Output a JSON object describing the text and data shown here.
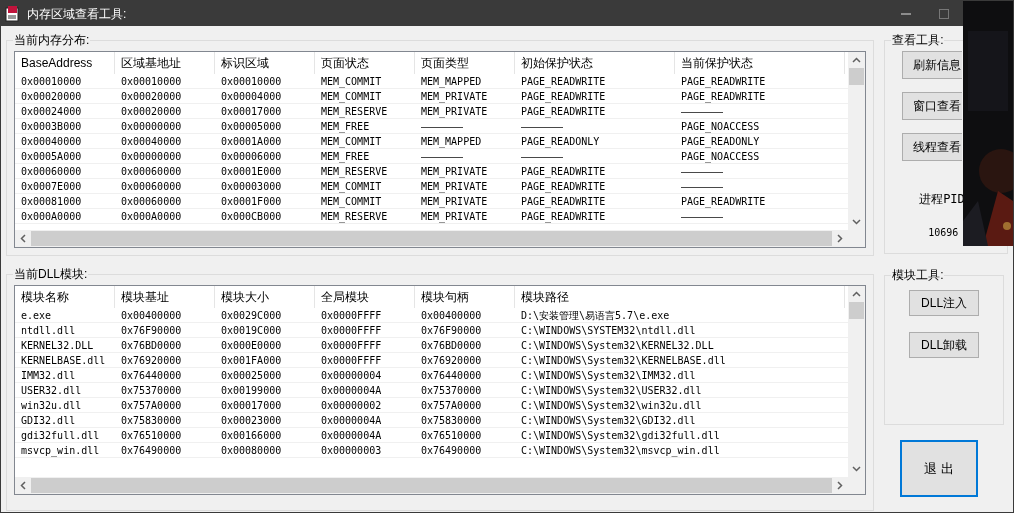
{
  "window": {
    "title": "内存区域查看工具:"
  },
  "memory_group": {
    "title": "当前内存分布:",
    "columns": [
      "BaseAddress",
      "区域基地址",
      "标识区域",
      "页面状态",
      "页面类型",
      "初始保护状态",
      "当前保护状态"
    ],
    "rows": [
      [
        "0x00010000",
        "0x00010000",
        "0x00010000",
        "MEM_COMMIT",
        "MEM_MAPPED",
        "PAGE_READWRITE",
        "PAGE_READWRITE"
      ],
      [
        "0x00020000",
        "0x00020000",
        "0x00004000",
        "MEM_COMMIT",
        "MEM_PRIVATE",
        "PAGE_READWRITE",
        "PAGE_READWRITE"
      ],
      [
        "0x00024000",
        "0x00020000",
        "0x00017000",
        "MEM_RESERVE",
        "MEM_PRIVATE",
        "PAGE_READWRITE",
        "———————"
      ],
      [
        "0x0003B000",
        "0x00000000",
        "0x00005000",
        "MEM_FREE",
        "———————",
        "———————",
        "PAGE_NOACCESS"
      ],
      [
        "0x00040000",
        "0x00040000",
        "0x0001A000",
        "MEM_COMMIT",
        "MEM_MAPPED",
        "PAGE_READONLY",
        "PAGE_READONLY"
      ],
      [
        "0x0005A000",
        "0x00000000",
        "0x00006000",
        "MEM_FREE",
        "———————",
        "———————",
        "PAGE_NOACCESS"
      ],
      [
        "0x00060000",
        "0x00060000",
        "0x0001E000",
        "MEM_RESERVE",
        "MEM_PRIVATE",
        "PAGE_READWRITE",
        "———————"
      ],
      [
        "0x0007E000",
        "0x00060000",
        "0x00003000",
        "MEM_COMMIT",
        "MEM_PRIVATE",
        "PAGE_READWRITE",
        "———————"
      ],
      [
        "0x00081000",
        "0x00060000",
        "0x0001F000",
        "MEM_COMMIT",
        "MEM_PRIVATE",
        "PAGE_READWRITE",
        "PAGE_READWRITE"
      ],
      [
        "0x000A0000",
        "0x000A0000",
        "0x000CB000",
        "MEM_RESERVE",
        "MEM_PRIVATE",
        "PAGE_READWRITE",
        "———————"
      ]
    ]
  },
  "view_tools": {
    "title": "查看工具:",
    "buttons": [
      "刷新信息",
      "窗口查看",
      "线程查看"
    ],
    "pid_label": "进程PID",
    "pid_value": "10696"
  },
  "dll_group": {
    "title": "当前DLL模块:",
    "columns": [
      "模块名称",
      "模块基址",
      "模块大小",
      "全局模块",
      "模块句柄",
      "模块路径"
    ],
    "rows": [
      [
        "e.exe",
        "0x00400000",
        "0x0029C000",
        "0x0000FFFF",
        "0x00400000",
        "D:\\安装管理\\易语言5.7\\e.exe"
      ],
      [
        "ntdll.dll",
        "0x76F90000",
        "0x0019C000",
        "0x0000FFFF",
        "0x76F90000",
        "C:\\WINDOWS\\SYSTEM32\\ntdll.dll"
      ],
      [
        "KERNEL32.DLL",
        "0x76BD0000",
        "0x000E0000",
        "0x0000FFFF",
        "0x76BD0000",
        "C:\\WINDOWS\\System32\\KERNEL32.DLL"
      ],
      [
        "KERNELBASE.dll",
        "0x76920000",
        "0x001FA000",
        "0x0000FFFF",
        "0x76920000",
        "C:\\WINDOWS\\System32\\KERNELBASE.dll"
      ],
      [
        "IMM32.dll",
        "0x76440000",
        "0x00025000",
        "0x00000004",
        "0x76440000",
        "C:\\WINDOWS\\System32\\IMM32.dll"
      ],
      [
        "USER32.dll",
        "0x75370000",
        "0x00199000",
        "0x0000004A",
        "0x75370000",
        "C:\\WINDOWS\\System32\\USER32.dll"
      ],
      [
        "win32u.dll",
        "0x757A0000",
        "0x00017000",
        "0x00000002",
        "0x757A0000",
        "C:\\WINDOWS\\System32\\win32u.dll"
      ],
      [
        "GDI32.dll",
        "0x75830000",
        "0x00023000",
        "0x0000004A",
        "0x75830000",
        "C:\\WINDOWS\\System32\\GDI32.dll"
      ],
      [
        "gdi32full.dll",
        "0x76510000",
        "0x00166000",
        "0x0000004A",
        "0x76510000",
        "C:\\WINDOWS\\System32\\gdi32full.dll"
      ],
      [
        "msvcp_win.dll",
        "0x76490000",
        "0x00080000",
        "0x00000003",
        "0x76490000",
        "C:\\WINDOWS\\System32\\msvcp_win.dll"
      ]
    ]
  },
  "module_tools": {
    "title": "模块工具:",
    "buttons": [
      "DLL注入",
      "DLL卸载"
    ]
  },
  "exit_button": {
    "label": "退 出",
    "focused": true
  }
}
